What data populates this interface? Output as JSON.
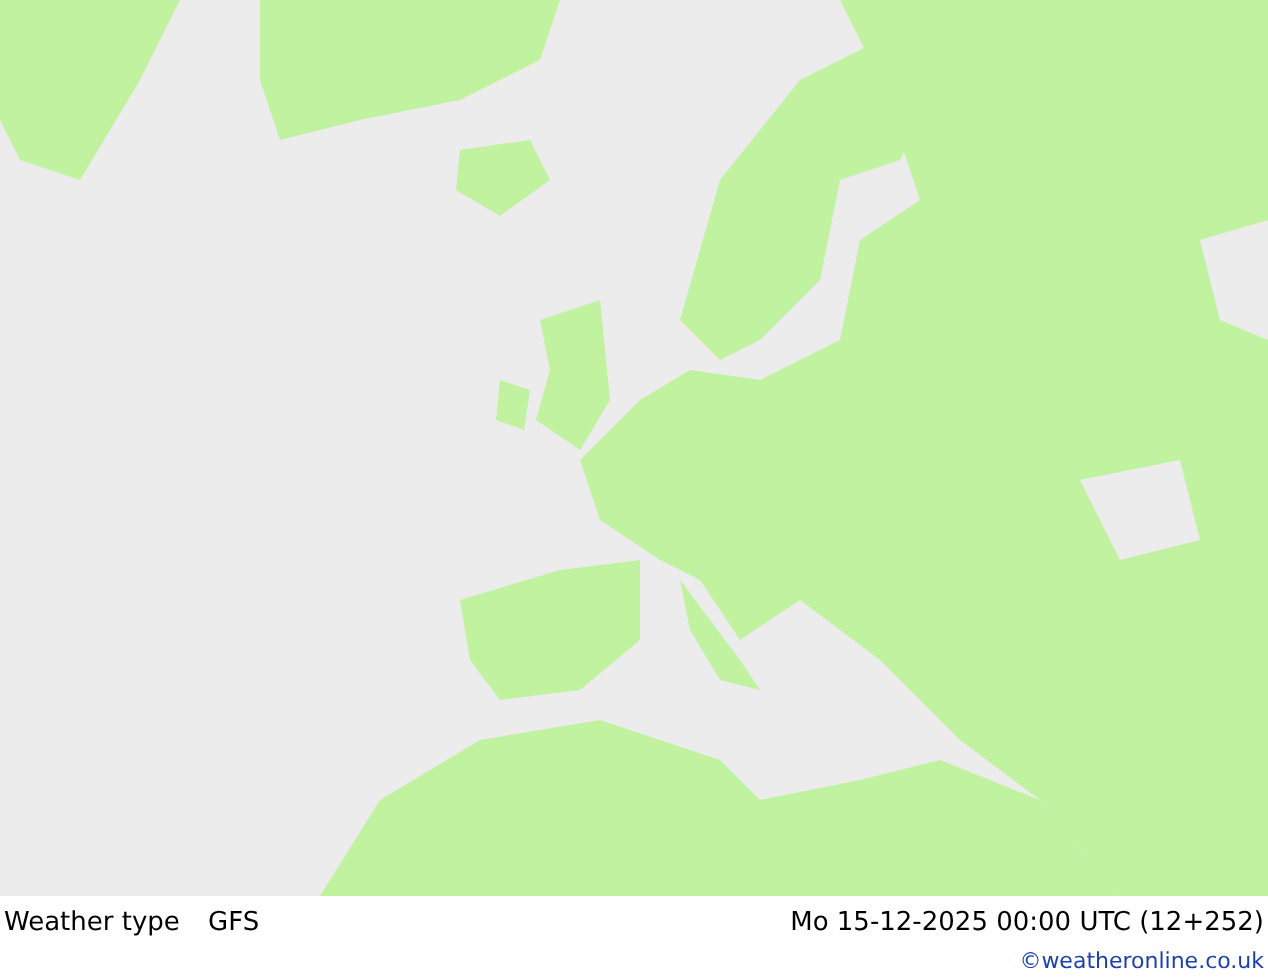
{
  "footer": {
    "title": "Weather type",
    "model": "GFS",
    "datetime": "Mo 15-12-2025 00:00 UTC (12+252)",
    "credit": "©weatheronline.co.uk"
  }
}
